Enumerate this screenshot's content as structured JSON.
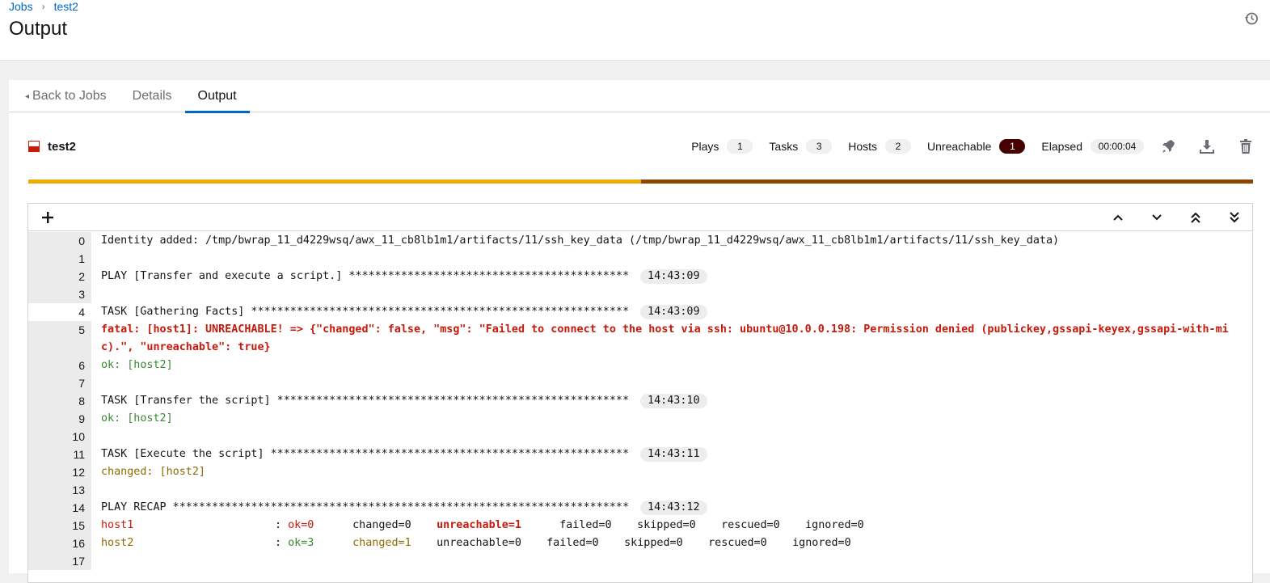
{
  "breadcrumb": {
    "jobs": "Jobs",
    "separator": "›",
    "current": "test2"
  },
  "page": {
    "title": "Output"
  },
  "tabs": [
    {
      "label": "Back to Jobs",
      "caret": "◂"
    },
    {
      "label": "Details"
    },
    {
      "label": "Output"
    }
  ],
  "job": {
    "name": "test2"
  },
  "counts": {
    "plays_label": "Plays",
    "plays": "1",
    "tasks_label": "Tasks",
    "tasks": "3",
    "hosts_label": "Hosts",
    "hosts": "2",
    "unreachable_label": "Unreachable",
    "unreachable": "1",
    "elapsed_label": "Elapsed",
    "elapsed": "00:00:04"
  },
  "progress": {
    "ok_fraction": 0.5,
    "unreachable_fraction": 0.5
  },
  "colors": {
    "ok": "#f0ab00",
    "unreachable": "#8f4700",
    "fatal": "#c9190b",
    "ok_text": "#3e8635",
    "changed_text": "#8f6a00"
  },
  "icons": [
    "history-icon",
    "rocket-icon",
    "download-icon",
    "trash-icon",
    "plus-icon",
    "chevron-up-icon",
    "chevron-down-icon",
    "double-chevron-up-icon",
    "double-chevron-down-icon"
  ],
  "output": {
    "l0": "Identity added: /tmp/bwrap_11_d4229wsq/awx_11_cb8lb1m1/artifacts/11/ssh_key_data (/tmp/bwrap_11_d4229wsq/awx_11_cb8lb1m1/artifacts/11/ssh_key_data)",
    "l2": "PLAY [Transfer and execute a script.] *******************************************",
    "l2_ts": "14:43:09",
    "l4": "TASK [Gathering Facts] **********************************************************",
    "l4_ts": "14:43:09",
    "l5": "fatal: [host1]: UNREACHABLE! => {\"changed\": false, \"msg\": \"Failed to connect to the host via ssh: ubuntu@10.0.0.198: Permission denied (publickey,gssapi-keyex,gssapi-with-mic).\", \"unreachable\": true}",
    "l6": "ok: [host2]",
    "l8": "TASK [Transfer the script] ******************************************************",
    "l8_ts": "14:43:10",
    "l9": "ok: [host2]",
    "l11": "TASK [Execute the script] *******************************************************",
    "l11_ts": "14:43:11",
    "l12": "changed: [host2]",
    "l14": "PLAY RECAP **********************************************************************",
    "l14_ts": "14:43:12",
    "recap1": {
      "host": "host1",
      "sep": ": ",
      "ok": "ok=0",
      "changed": "changed=0",
      "unreachable": "unreachable=1",
      "failed": "failed=0",
      "skipped": "skipped=0",
      "rescued": "rescued=0",
      "ignored": "ignored=0"
    },
    "recap2": {
      "host": "host2",
      "sep": ": ",
      "ok": "ok=3",
      "changed": "changed=1",
      "unreachable": "unreachable=0",
      "failed": "failed=0",
      "skipped": "skipped=0",
      "rescued": "rescued=0",
      "ignored": "ignored=0"
    }
  }
}
